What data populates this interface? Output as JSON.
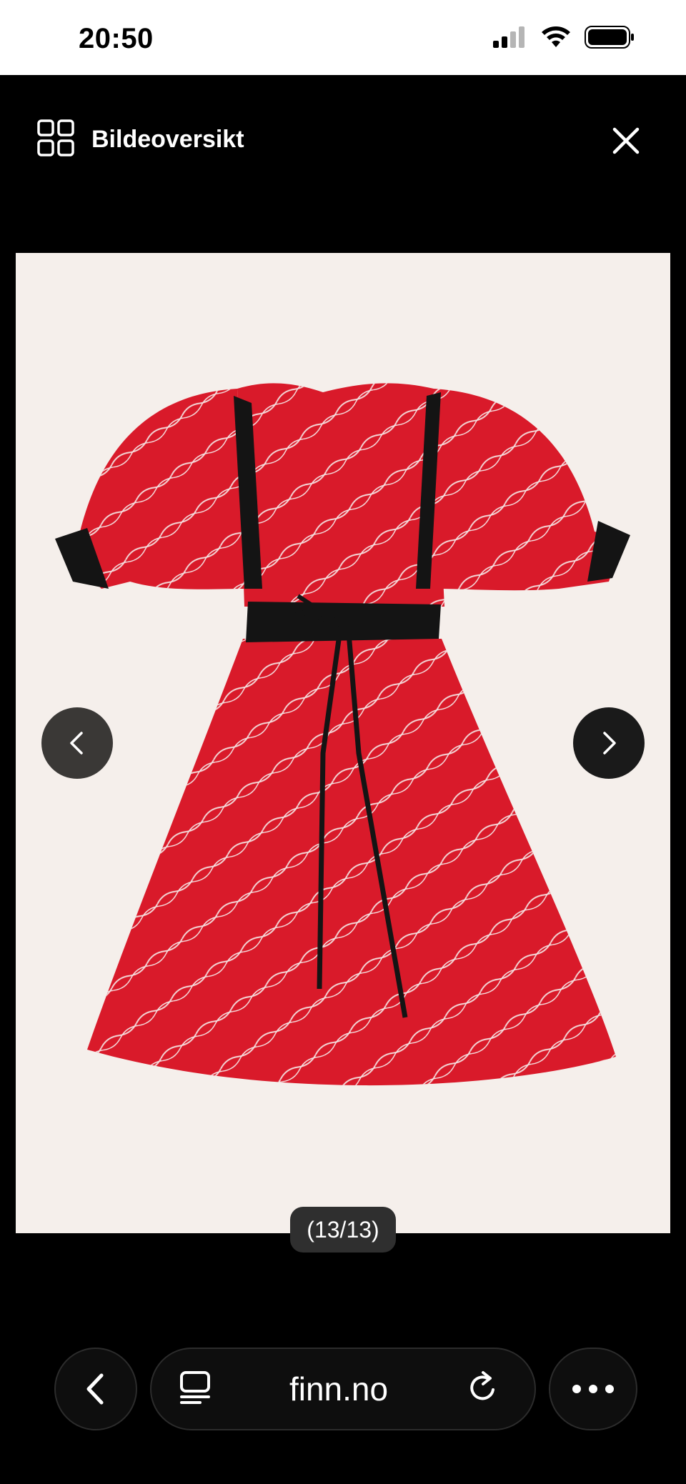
{
  "status_bar": {
    "time": "20:50",
    "icons": [
      "cellular-signal-icon",
      "wifi-icon",
      "battery-icon"
    ]
  },
  "viewer": {
    "overview_label": "Bildeoversikt",
    "overview_icon": "grid-icon",
    "close_icon": "close-icon",
    "counter": "(13/13)",
    "image_description_icon": "dress-photo",
    "prev_icon": "chevron-left-icon",
    "next_icon": "chevron-right-icon"
  },
  "browser": {
    "url": "finn.no",
    "back_icon": "chevron-left-icon",
    "tabs_icon": "tabs-icon",
    "reload_icon": "reload-icon",
    "more_icon": "more-icon"
  },
  "colors": {
    "dress_red": "#d91a2a",
    "trim_black": "#141414",
    "background": "#f5efeb"
  }
}
